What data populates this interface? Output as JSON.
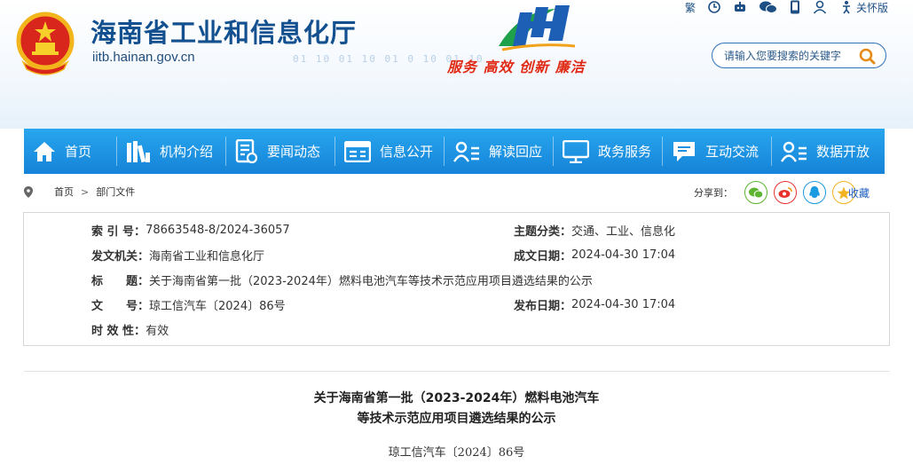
{
  "header": {
    "site_title": "海南省工业和信息化厅",
    "site_domain": "iitb.hainan.gov.cn",
    "slogan": "服务 高效 创新 廉洁",
    "bits": "01   10   01   10   01    0  10   01   10",
    "top_links": {
      "simplified_label": "繁",
      "elderly_label": "关怀版"
    },
    "search_placeholder": "请输入您要搜索的关键字"
  },
  "nav": {
    "items": [
      {
        "label": "首页",
        "icon": "home-icon"
      },
      {
        "label": "机构介绍",
        "icon": "books-icon"
      },
      {
        "label": "要闻动态",
        "icon": "news-doc-icon"
      },
      {
        "label": "信息公开",
        "icon": "info-icon"
      },
      {
        "label": "解读回应",
        "icon": "user-list-icon"
      },
      {
        "label": "政务服务",
        "icon": "monitor-icon"
      },
      {
        "label": "互动交流",
        "icon": "chat-icon"
      },
      {
        "label": "数据开放",
        "icon": "user-data-icon"
      }
    ]
  },
  "breadcrumb": {
    "home": "首页",
    "separator": ">",
    "current": "部门文件"
  },
  "share": {
    "label": "分享到：",
    "favorite_label": "收藏"
  },
  "meta": {
    "index_no_label": "索 引 号：",
    "index_no": "78663548-8/2024-36057",
    "topic_label": "主题分类：",
    "topic": "交通、工业、信息化",
    "issuer_label": "发文机关：",
    "issuer": "海南省工业和信息化厅",
    "created_label": "成文日期：",
    "created": "2024-04-30 17:04",
    "title_label": "标　　题：",
    "title": "关于海南省第一批（2023-2024年）燃料电池汽车等技术示范应用项目遴选结果的公示",
    "doc_no_label": "文　　号：",
    "doc_no": "琼工信汽车〔2024〕86号",
    "published_label": "发布日期：",
    "published": "2024-04-30 17:04",
    "validity_label": "时 效 性：",
    "validity": "有效"
  },
  "article": {
    "title_line1": "关于海南省第一批（2023-2024年）燃料电池汽车",
    "title_line2": "等技术示范应用项目遴选结果的公示",
    "doc_number": "琼工信汽车〔2024〕86号"
  },
  "colors": {
    "nav_blue": "#1a90e0",
    "title_blue": "#13508f",
    "slogan_red": "#e02a14"
  }
}
